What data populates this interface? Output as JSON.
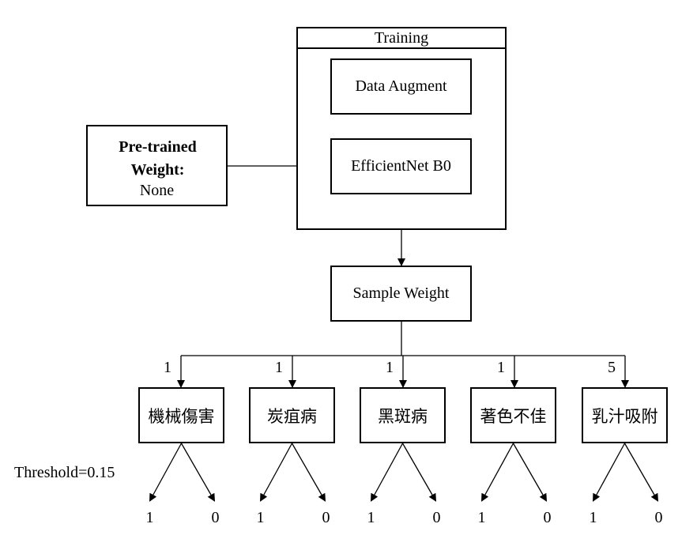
{
  "training": {
    "title": "Training"
  },
  "nodes": {
    "data_augment": "Data Augment",
    "efficientnet": "EfficientNet B0",
    "pretrained_title": "Pre-trained Weight:",
    "pretrained_value": "None",
    "sample_weight": "Sample Weight"
  },
  "threshold": "Threshold=0.15",
  "classes": [
    {
      "label": "機械傷害",
      "weight": "1",
      "out1": "1",
      "out0": "0"
    },
    {
      "label": "炭疽病",
      "weight": "1",
      "out1": "1",
      "out0": "0"
    },
    {
      "label": "黑斑病",
      "weight": "1",
      "out1": "1",
      "out0": "0"
    },
    {
      "label": "著色不佳",
      "weight": "1",
      "out1": "1",
      "out0": "0"
    },
    {
      "label": "乳汁吸附",
      "weight": "5",
      "out1": "1",
      "out0": "0"
    }
  ]
}
